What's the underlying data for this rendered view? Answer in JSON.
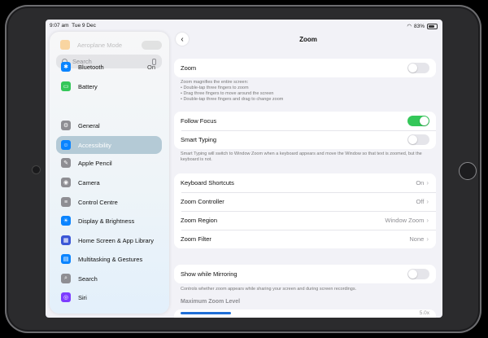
{
  "status": {
    "time": "9:07 am",
    "date": "Tue 9 Dec",
    "battery": "83%"
  },
  "sidebar": {
    "airplane_label": "Aeroplane Mode",
    "search_placeholder": "Search",
    "items": [
      {
        "label": "Bluetooth",
        "value": "On",
        "icon": "bluetooth-icon",
        "color": "#0a84ff",
        "glyph": "✱"
      },
      {
        "label": "Battery",
        "value": "",
        "icon": "battery-icon",
        "color": "#34c759",
        "glyph": "▭"
      },
      {
        "label": "General",
        "value": "",
        "icon": "gear-icon",
        "color": "#8e8e93",
        "glyph": "⚙"
      },
      {
        "label": "Accessibility",
        "value": "",
        "icon": "accessibility-icon",
        "color": "#0a84ff",
        "glyph": "☺"
      },
      {
        "label": "Apple Pencil",
        "value": "",
        "icon": "pencil-icon",
        "color": "#8e8e93",
        "glyph": "✎"
      },
      {
        "label": "Camera",
        "value": "",
        "icon": "camera-icon",
        "color": "#8e8e93",
        "glyph": "◉"
      },
      {
        "label": "Control Centre",
        "value": "",
        "icon": "control-centre-icon",
        "color": "#8e8e93",
        "glyph": "≡"
      },
      {
        "label": "Display & Brightness",
        "value": "",
        "icon": "brightness-icon",
        "color": "#0a84ff",
        "glyph": "☀"
      },
      {
        "label": "Home Screen & App Library",
        "value": "",
        "icon": "home-screen-icon",
        "color": "#3a56d6",
        "glyph": "▦"
      },
      {
        "label": "Multitasking & Gestures",
        "value": "",
        "icon": "multitasking-icon",
        "color": "#0a84ff",
        "glyph": "▤"
      },
      {
        "label": "Search",
        "value": "",
        "icon": "search-icon",
        "color": "#8e8e93",
        "glyph": "⌕"
      },
      {
        "label": "Siri",
        "value": "",
        "icon": "siri-icon",
        "color": "#7d3cff",
        "glyph": "◎"
      }
    ]
  },
  "detail": {
    "title": "Zoom",
    "zoom_label": "Zoom",
    "zoom_note": [
      "Zoom magnifies the entire screen:",
      "• Double-tap three fingers to zoom",
      "• Drag three fingers to move around the screen",
      "• Double-tap three fingers and drag to change zoom"
    ],
    "follow_focus_label": "Follow Focus",
    "smart_typing_label": "Smart Typing",
    "smart_note": "Smart Typing will switch to Window Zoom when a keyboard appears and move the Window so that text is zoomed, but the keyboard is not.",
    "nav_rows": [
      {
        "label": "Keyboard Shortcuts",
        "value": "On"
      },
      {
        "label": "Zoom Controller",
        "value": "Off"
      },
      {
        "label": "Zoom Region",
        "value": "Window Zoom"
      },
      {
        "label": "Zoom Filter",
        "value": "None"
      }
    ],
    "mirroring_label": "Show while Mirroring",
    "mirroring_note": "Controls whether zoom appears while sharing your screen and during screen recordings.",
    "max_zoom_header": "Maximum Zoom Level",
    "max_zoom_value": "5.0x",
    "max_zoom_fraction": 0.28
  },
  "colors": {
    "accent": "#0a84ff",
    "toggle_on": "#34c759",
    "selection": "#b4cad6"
  }
}
